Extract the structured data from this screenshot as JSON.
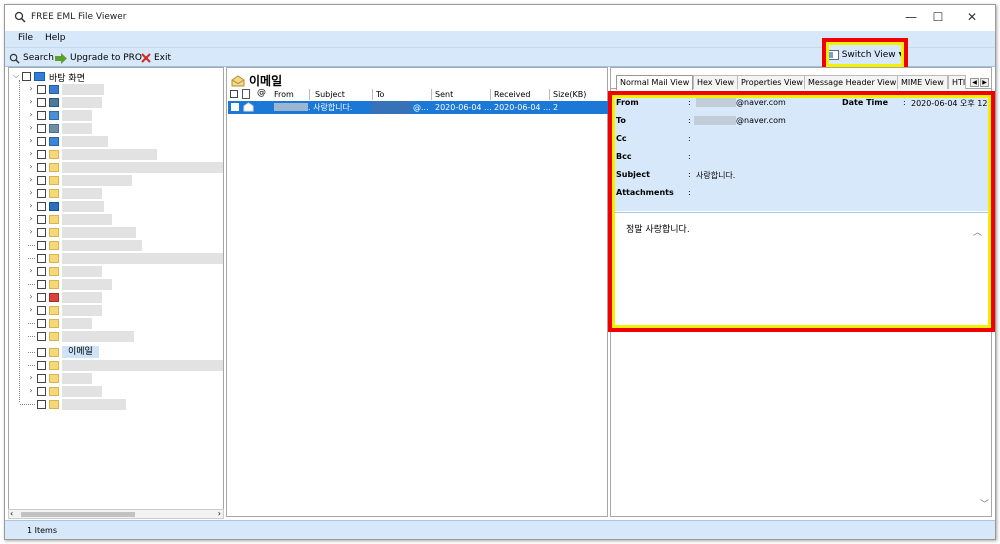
{
  "window": {
    "title": "FREE EML File Viewer",
    "minimize": "—",
    "maximize": "☐",
    "close": "✕"
  },
  "menu": {
    "items": [
      "File",
      "Help"
    ]
  },
  "toolbar": {
    "search": "Search",
    "upgrade": "Upgrade to PRO",
    "exit": "Exit",
    "switch_view": "Switch View"
  },
  "tree": {
    "root_label": "바탕 화면",
    "selected_label": "이메일"
  },
  "list": {
    "title": "이메일",
    "columns": [
      "From",
      "Subject",
      "To",
      "Sent",
      "Received",
      "Size(KB)"
    ],
    "rows": [
      {
        "from": "",
        "subject": "사랑합니다.",
        "to": "@...",
        "sent": "2020-06-04 ...",
        "received": "2020-06-04 ...",
        "size": "2"
      }
    ]
  },
  "preview": {
    "tabs": [
      "Normal Mail View",
      "Hex View",
      "Properties View",
      "Message Header View",
      "MIME View",
      "HTI"
    ],
    "active_tab": "Normal Mail View",
    "fields": {
      "from_label": "From",
      "from_value": "@naver.com",
      "to_label": "To",
      "to_value": "@naver.com",
      "cc_label": "Cc",
      "bcc_label": "Bcc",
      "subject_label": "Subject",
      "subject_value": "사랑합니다.",
      "attachments_label": "Attachments",
      "date_label": "Date Time",
      "date_value": "2020-06-04 오후 12:"
    },
    "body": "정말 사랑합니다."
  },
  "status": {
    "text": "1 Items"
  },
  "colors": {
    "chrome": "#d7e8fa",
    "selection": "#1b78d6",
    "highlight_border": "#f20000",
    "highlight_outline": "#f1f100"
  }
}
